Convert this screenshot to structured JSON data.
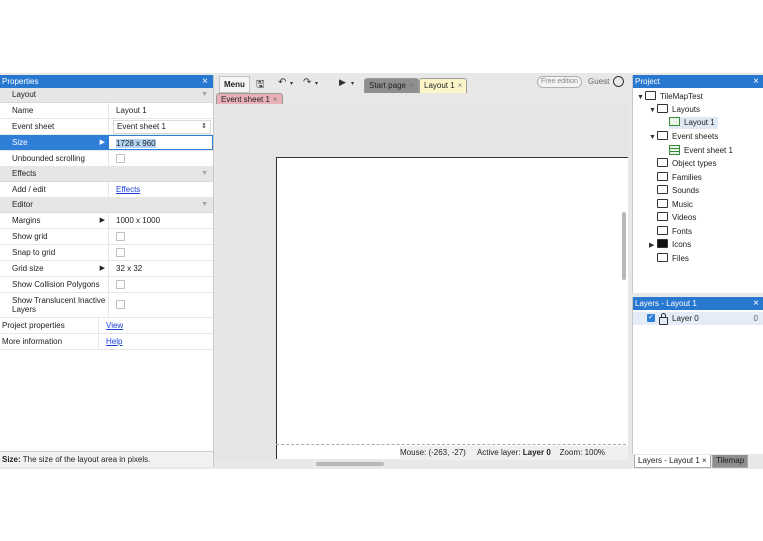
{
  "properties": {
    "title": "Properties",
    "close": "×",
    "sections": [
      {
        "label": "Layout",
        "rows": [
          {
            "key": "Name",
            "value": "Layout 1",
            "kind": "text"
          },
          {
            "key": "Event sheet",
            "value": "Event sheet 1",
            "kind": "select"
          },
          {
            "key": "Size",
            "value": "1728 x 960",
            "kind": "input",
            "selected": true,
            "expandable": true
          },
          {
            "key": "Unbounded scrolling",
            "value": "",
            "kind": "checkbox"
          }
        ]
      },
      {
        "label": "Effects",
        "rows": [
          {
            "key": "Add / edit",
            "value": "Effects",
            "kind": "link"
          }
        ]
      },
      {
        "label": "Editor",
        "rows": [
          {
            "key": "Margins",
            "value": "1000 x 1000",
            "kind": "text",
            "expandable": true
          },
          {
            "key": "Show grid",
            "value": "",
            "kind": "checkbox"
          },
          {
            "key": "Snap to grid",
            "value": "",
            "kind": "checkbox"
          },
          {
            "key": "Grid size",
            "value": "32 x 32",
            "kind": "text",
            "expandable": true
          },
          {
            "key": "Show Collision Polygons",
            "value": "",
            "kind": "checkbox"
          },
          {
            "key": "Show Translucent Inactive Layers",
            "value": "",
            "kind": "checkbox",
            "tall": true
          }
        ]
      }
    ],
    "footer_rows": [
      {
        "key": "Project properties",
        "value": "View"
      },
      {
        "key": "More information",
        "value": "Help"
      }
    ],
    "help": {
      "label": "Size:",
      "text": " The size of the layout area in pixels."
    }
  },
  "toolbar": {
    "menu_label": "Menu",
    "tabs": [
      {
        "label": "Start page",
        "close": "×",
        "color": "#8e8e8e"
      },
      {
        "label": "Layout 1",
        "close": "×",
        "color": "#fdf4c8"
      }
    ],
    "subtab": {
      "label": "Event sheet 1",
      "close": "×",
      "color": "#e7b0b7"
    },
    "edition": "Free edition",
    "user": "Guest"
  },
  "status": {
    "mouse_label": "Mouse: (-263, -27)",
    "layer_label": "Active layer:",
    "layer_value": "Layer 0",
    "zoom_label": "Zoom: 100%"
  },
  "project": {
    "title": "Project",
    "close": "×",
    "items": [
      {
        "label": "TileMapTest"
      },
      {
        "label": "Layouts"
      },
      {
        "label": "Layout 1"
      },
      {
        "label": "Event sheets"
      },
      {
        "label": "Event sheet 1"
      },
      {
        "label": "Object types"
      },
      {
        "label": "Families"
      },
      {
        "label": "Sounds"
      },
      {
        "label": "Music"
      },
      {
        "label": "Videos"
      },
      {
        "label": "Fonts"
      },
      {
        "label": "Icons"
      },
      {
        "label": "Files"
      }
    ]
  },
  "layers": {
    "title": "Layers - Layout 1",
    "close": "×",
    "rows": [
      {
        "name": "Layer 0",
        "index": "0",
        "visible": true
      }
    ],
    "tabs": [
      {
        "label": "Layers - Layout 1",
        "close": "×"
      },
      {
        "label": "Tilemap"
      }
    ]
  },
  "colors": {
    "accent": "#2878d0",
    "selection": "#2f7ed8",
    "layout_tab": "#fdf4c8",
    "eventsheet_tab": "#e7b0b7"
  }
}
